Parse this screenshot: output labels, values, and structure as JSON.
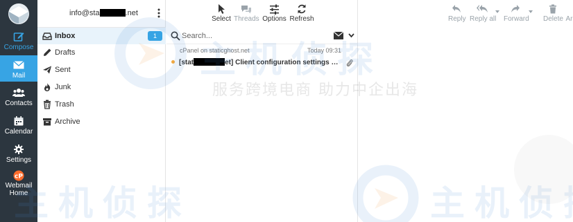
{
  "nav": {
    "items": [
      {
        "label": "Compose",
        "icon": "compose-icon"
      },
      {
        "label": "Mail",
        "icon": "envelope-icon"
      },
      {
        "label": "Contacts",
        "icon": "users-icon"
      },
      {
        "label": "Calendar",
        "icon": "calendar-icon"
      },
      {
        "label": "Settings",
        "icon": "gear-icon"
      },
      {
        "label": "Webmail Home",
        "icon": "cpanel-icon"
      }
    ],
    "active_item": "Mail"
  },
  "account": {
    "email_prefix": "info@sta",
    "email_suffix": ".net"
  },
  "folders": {
    "active": "Inbox",
    "items": [
      {
        "label": "Inbox",
        "unread": "1",
        "icon": "inbox-icon"
      },
      {
        "label": "Drafts",
        "icon": "pencil-icon"
      },
      {
        "label": "Sent",
        "icon": "paper-plane-icon"
      },
      {
        "label": "Junk",
        "icon": "fire-icon"
      },
      {
        "label": "Trash",
        "icon": "trash-icon"
      },
      {
        "label": "Archive",
        "icon": "archive-box-icon"
      }
    ]
  },
  "list_toolbar": {
    "select": "Select",
    "threads": "Threads",
    "options": "Options",
    "refresh": "Refresh"
  },
  "search": {
    "placeholder": "Search..."
  },
  "messages": [
    {
      "from": "cPanel on staticghost.net",
      "date": "Today 09:31",
      "subject_prefix": "[stat",
      "subject_mid": "et] Client configuration settings for \"i...",
      "has_attachment": true,
      "unread": true
    }
  ],
  "message_toolbar": {
    "reply": "Reply",
    "reply_all": "Reply all",
    "forward": "Forward",
    "delete": "Delete",
    "archive_partial": "Ar"
  },
  "watermark": {
    "brand": "主机侦探",
    "slogan": "服务跨境电商 助力中企出海"
  },
  "colors": {
    "nav_bg": "#2c363f",
    "accent": "#37a4e4",
    "unread_dot": "#f0a840",
    "active_folder_bg": "#e8f3fb"
  }
}
